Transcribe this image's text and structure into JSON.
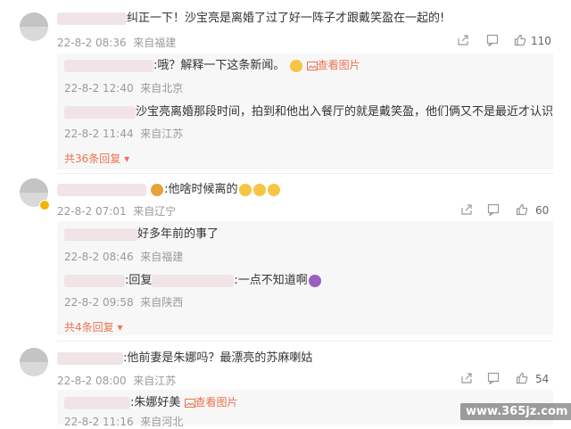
{
  "comment1": {
    "text": "纠正一下！沙宝亮是离婚了过了好一阵子才跟戴笑盈在一起的!",
    "date": "22-8-2 08:36",
    "location": "来自福建",
    "likes": "110",
    "replies": [
      {
        "text": ":哦？解释一下这条新闻。",
        "link": "查看图片",
        "date": "22-8-2 12:40",
        "location": "来自北京"
      },
      {
        "text": "沙宝亮离婚那段时间，拍到和他出入餐厅的就是戴笑盈，他们俩又不是最近才认识",
        "date": "22-8-2 11:44",
        "location": "来自江苏"
      }
    ],
    "more": "共36条回复"
  },
  "comment2": {
    "text": ":他啥时候离的",
    "date": "22-8-2 07:01",
    "location": "来自辽宁",
    "likes": "60",
    "replies": [
      {
        "text": "好多年前的事了",
        "date": "22-8-2 08:46",
        "location": "来自福建"
      },
      {
        "text_a": ":回复",
        "text_b": ":一点不知道啊",
        "date": "22-8-2 09:58",
        "location": "来自陕西"
      }
    ],
    "more": "共4条回复"
  },
  "comment3": {
    "text": ":他前妻是朱娜吗？最漂亮的苏麻喇姑",
    "date": "22-8-2 08:00",
    "location": "来自江苏",
    "likes": "54",
    "replies": [
      {
        "text": ":朱娜好美",
        "link": "查看图片",
        "date": "22-8-2 11:16",
        "location": "来自河北"
      }
    ]
  },
  "watermark": "www.365jz.com"
}
